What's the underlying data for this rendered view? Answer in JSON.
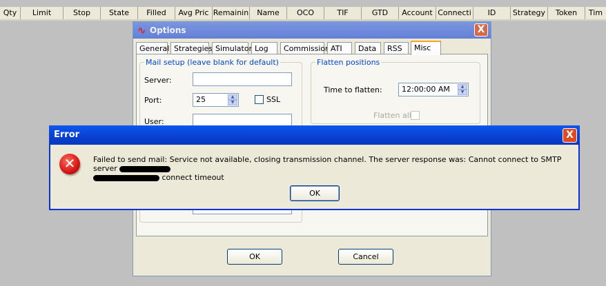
{
  "columns": [
    "Qty",
    "Limit",
    "Stop",
    "State",
    "Filled",
    "Avg Pric",
    "Remainin",
    "Name",
    "OCO",
    "TIF",
    "GTD",
    "Account",
    "Connecti",
    "ID",
    "Strategy",
    "Token",
    "Tim"
  ],
  "options": {
    "title": "Options",
    "close": "X",
    "tabs": [
      "General",
      "Strategies",
      "Simulator",
      "Log",
      "Commission",
      "ATI",
      "Data",
      "RSS",
      "Misc"
    ],
    "active_tab": "Misc",
    "mail": {
      "legend": "Mail setup (leave blank for default)",
      "server_label": "Server:",
      "server_value": "",
      "port_label": "Port:",
      "port_value": "25",
      "ssl_label": "SSL",
      "user_label": "User:",
      "user_value": ""
    },
    "flatten": {
      "legend": "Flatten positions",
      "time_label": "Time to flatten:",
      "time_value": "12:00:00 AM",
      "flatten_all_label": "Flatten all"
    },
    "ok_label": "OK",
    "cancel_label": "Cancel"
  },
  "error": {
    "title": "Error",
    "close": "X",
    "icon": "error-icon",
    "message_part1": "Failed to send mail: Service not available, closing transmission channel. The server response was: Cannot connect to SMTP server",
    "message_part2": "connect timeout",
    "ok_label": "OK"
  },
  "colors": {
    "error_titlebar": "#0a4fe0",
    "options_titlebar": "#7a96df",
    "legend_blue": "#0046d5",
    "active_tab_accent": "#f5a623"
  }
}
